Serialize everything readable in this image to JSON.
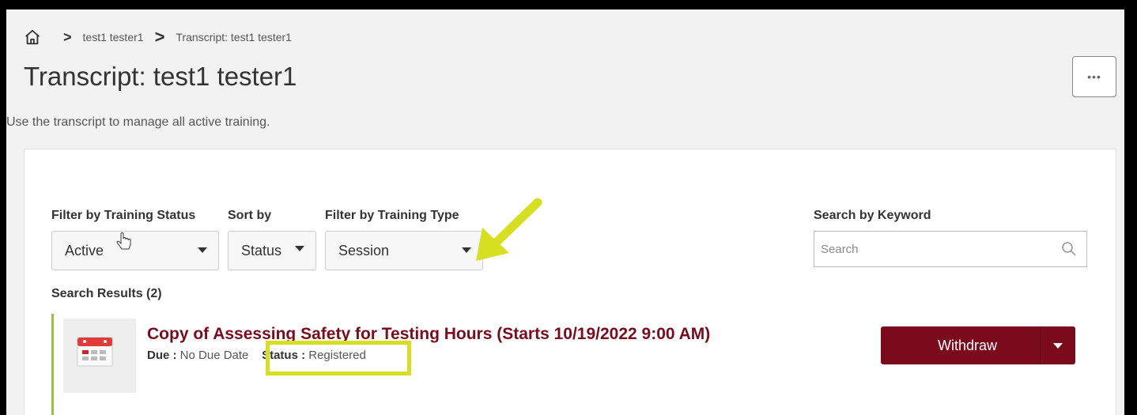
{
  "breadcrumb": {
    "home_icon": "home-icon",
    "crumbs": [
      "test1 tester1",
      "Transcript: test1 tester1"
    ]
  },
  "page": {
    "title": "Transcript: test1 tester1",
    "more_label": "•••",
    "description": "Use the transcript to manage all active training."
  },
  "filters": {
    "status": {
      "label": "Filter by Training Status",
      "value": "Active"
    },
    "sort": {
      "label": "Sort by",
      "value": "Status"
    },
    "type": {
      "label": "Filter by Training Type",
      "value": "Session"
    },
    "keyword": {
      "label": "Search by Keyword",
      "placeholder": "Search"
    }
  },
  "results": {
    "label": "Search Results (2)",
    "items": [
      {
        "title": "Copy of Assessing Safety for Testing Hours (Starts 10/19/2022 9:00 AM)",
        "due_label": "Due :",
        "due_value": "No Due Date",
        "status_label": "Status :",
        "status_value": "Registered",
        "action_label": "Withdraw"
      }
    ]
  },
  "colors": {
    "accent": "#7b0a1d",
    "annotation": "#d6e021",
    "item_border": "#8cc63f"
  }
}
